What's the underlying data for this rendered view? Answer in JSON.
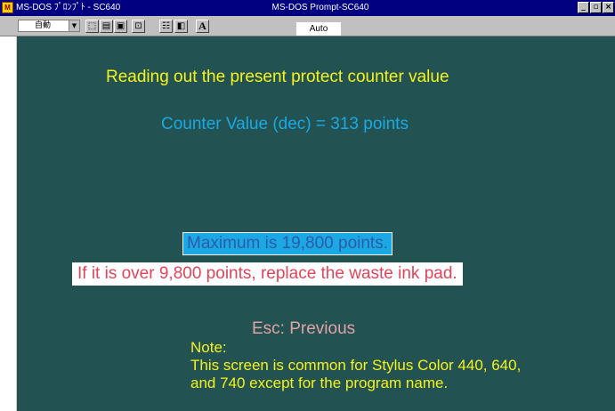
{
  "window": {
    "title": "MS-DOS ﾌﾟﾛﾝﾌﾟﾄ - SC640",
    "center_title": "MS-DOS Prompt-SC640",
    "app_icon": "msdos-icon",
    "caption": {
      "minimize": "_",
      "maximize": "▫",
      "close": "×"
    }
  },
  "toolbar": {
    "font_size_value": "自動",
    "status": "Auto",
    "buttons": [
      {
        "icon": "mark-icon",
        "glyph": "⬚"
      },
      {
        "icon": "copy-icon",
        "glyph": "▤"
      },
      {
        "icon": "paste-icon",
        "glyph": "▣"
      },
      {
        "icon": "fullscreen-icon",
        "glyph": "⊡"
      },
      {
        "icon": "properties-icon",
        "glyph": "☷"
      },
      {
        "icon": "background-icon",
        "glyph": "◧"
      },
      {
        "icon": "font-icon",
        "glyph": "A"
      }
    ]
  },
  "console": {
    "heading": "Reading out the present protect counter value",
    "counter": "Counter Value (dec) = 313 points",
    "maximum": "Maximum  is  19,800  points.",
    "warning": "If it is over 9,800 points, replace the waste ink pad.",
    "esc": "Esc: Previous",
    "note_lines": [
      "Note:",
      "This screen is common for Stylus Color 440, 640,",
      "and 740 except for the program name."
    ]
  },
  "colors": {
    "console_bg": "#235252",
    "yellow": "#f5f31c",
    "cyan": "#1aa9e3",
    "red": "#e0445a",
    "pink": "#e3a2a5",
    "title_bar": "#000080"
  }
}
